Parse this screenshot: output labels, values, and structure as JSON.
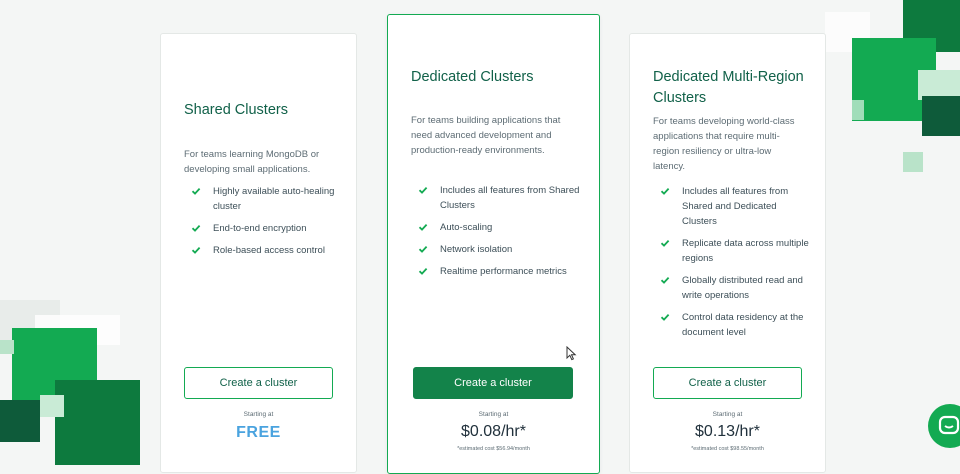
{
  "plans": [
    {
      "title": "Shared Clusters",
      "description": "For teams learning MongoDB or developing small applications.",
      "features": [
        "Highly available auto-healing cluster",
        "End-to-end encryption",
        "Role-based access control"
      ],
      "button_label": "Create a cluster",
      "starting_at": "Starting at",
      "price": "FREE",
      "note": ""
    },
    {
      "title": "Dedicated Clusters",
      "description": "For teams building applications that need advanced development and production-ready environments.",
      "features": [
        "Includes all features from Shared Clusters",
        "Auto-scaling",
        "Network isolation",
        "Realtime performance metrics"
      ],
      "button_label": "Create a cluster",
      "starting_at": "Starting at",
      "price": "$0.08/hr*",
      "note": "*estimated cost $56.94/month"
    },
    {
      "title": "Dedicated Multi-Region Clusters",
      "description": "For teams developing world-class applications that require multi-region resiliency or ultra-low latency.",
      "features": [
        "Includes all features from Shared and Dedicated Clusters",
        "Replicate data across multiple regions",
        "Globally distributed read and write operations",
        "Control data residency at the document level"
      ],
      "button_label": "Create a cluster",
      "starting_at": "Starting at",
      "price": "$0.13/hr*",
      "note": "*estimated cost $98.55/month"
    }
  ],
  "icons": {
    "feature": "check-icon",
    "chat": "chat-icon",
    "cursor": "mouse-cursor-icon"
  },
  "colors": {
    "brand_green": "#13aa52",
    "dark_green": "#116149",
    "button_primary": "#13834a",
    "free_blue": "#4aa3df"
  }
}
